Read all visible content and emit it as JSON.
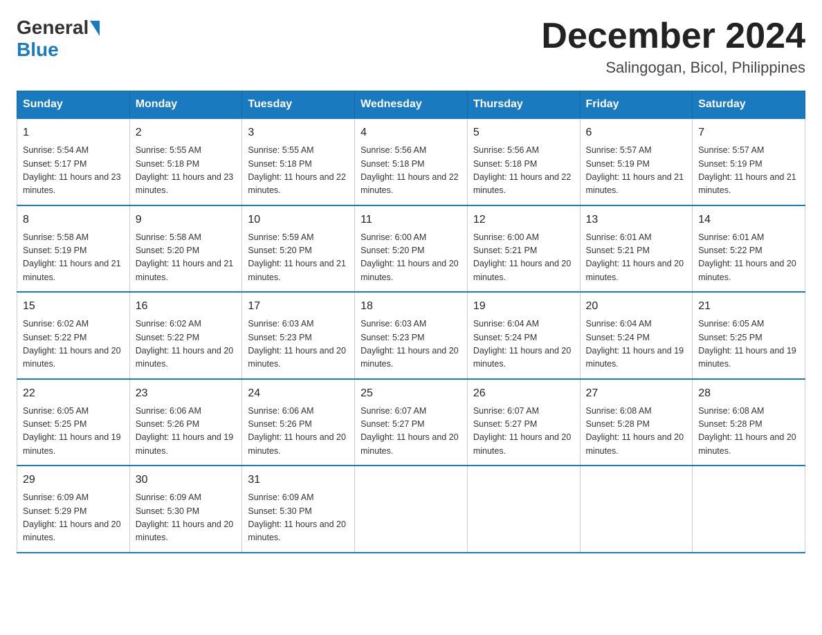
{
  "logo": {
    "general": "General",
    "blue": "Blue"
  },
  "title": "December 2024",
  "subtitle": "Salingogan, Bicol, Philippines",
  "days_of_week": [
    "Sunday",
    "Monday",
    "Tuesday",
    "Wednesday",
    "Thursday",
    "Friday",
    "Saturday"
  ],
  "weeks": [
    [
      {
        "day": "1",
        "sunrise": "5:54 AM",
        "sunset": "5:17 PM",
        "daylight": "11 hours and 23 minutes."
      },
      {
        "day": "2",
        "sunrise": "5:55 AM",
        "sunset": "5:18 PM",
        "daylight": "11 hours and 23 minutes."
      },
      {
        "day": "3",
        "sunrise": "5:55 AM",
        "sunset": "5:18 PM",
        "daylight": "11 hours and 22 minutes."
      },
      {
        "day": "4",
        "sunrise": "5:56 AM",
        "sunset": "5:18 PM",
        "daylight": "11 hours and 22 minutes."
      },
      {
        "day": "5",
        "sunrise": "5:56 AM",
        "sunset": "5:18 PM",
        "daylight": "11 hours and 22 minutes."
      },
      {
        "day": "6",
        "sunrise": "5:57 AM",
        "sunset": "5:19 PM",
        "daylight": "11 hours and 21 minutes."
      },
      {
        "day": "7",
        "sunrise": "5:57 AM",
        "sunset": "5:19 PM",
        "daylight": "11 hours and 21 minutes."
      }
    ],
    [
      {
        "day": "8",
        "sunrise": "5:58 AM",
        "sunset": "5:19 PM",
        "daylight": "11 hours and 21 minutes."
      },
      {
        "day": "9",
        "sunrise": "5:58 AM",
        "sunset": "5:20 PM",
        "daylight": "11 hours and 21 minutes."
      },
      {
        "day": "10",
        "sunrise": "5:59 AM",
        "sunset": "5:20 PM",
        "daylight": "11 hours and 21 minutes."
      },
      {
        "day": "11",
        "sunrise": "6:00 AM",
        "sunset": "5:20 PM",
        "daylight": "11 hours and 20 minutes."
      },
      {
        "day": "12",
        "sunrise": "6:00 AM",
        "sunset": "5:21 PM",
        "daylight": "11 hours and 20 minutes."
      },
      {
        "day": "13",
        "sunrise": "6:01 AM",
        "sunset": "5:21 PM",
        "daylight": "11 hours and 20 minutes."
      },
      {
        "day": "14",
        "sunrise": "6:01 AM",
        "sunset": "5:22 PM",
        "daylight": "11 hours and 20 minutes."
      }
    ],
    [
      {
        "day": "15",
        "sunrise": "6:02 AM",
        "sunset": "5:22 PM",
        "daylight": "11 hours and 20 minutes."
      },
      {
        "day": "16",
        "sunrise": "6:02 AM",
        "sunset": "5:22 PM",
        "daylight": "11 hours and 20 minutes."
      },
      {
        "day": "17",
        "sunrise": "6:03 AM",
        "sunset": "5:23 PM",
        "daylight": "11 hours and 20 minutes."
      },
      {
        "day": "18",
        "sunrise": "6:03 AM",
        "sunset": "5:23 PM",
        "daylight": "11 hours and 20 minutes."
      },
      {
        "day": "19",
        "sunrise": "6:04 AM",
        "sunset": "5:24 PM",
        "daylight": "11 hours and 20 minutes."
      },
      {
        "day": "20",
        "sunrise": "6:04 AM",
        "sunset": "5:24 PM",
        "daylight": "11 hours and 19 minutes."
      },
      {
        "day": "21",
        "sunrise": "6:05 AM",
        "sunset": "5:25 PM",
        "daylight": "11 hours and 19 minutes."
      }
    ],
    [
      {
        "day": "22",
        "sunrise": "6:05 AM",
        "sunset": "5:25 PM",
        "daylight": "11 hours and 19 minutes."
      },
      {
        "day": "23",
        "sunrise": "6:06 AM",
        "sunset": "5:26 PM",
        "daylight": "11 hours and 19 minutes."
      },
      {
        "day": "24",
        "sunrise": "6:06 AM",
        "sunset": "5:26 PM",
        "daylight": "11 hours and 20 minutes."
      },
      {
        "day": "25",
        "sunrise": "6:07 AM",
        "sunset": "5:27 PM",
        "daylight": "11 hours and 20 minutes."
      },
      {
        "day": "26",
        "sunrise": "6:07 AM",
        "sunset": "5:27 PM",
        "daylight": "11 hours and 20 minutes."
      },
      {
        "day": "27",
        "sunrise": "6:08 AM",
        "sunset": "5:28 PM",
        "daylight": "11 hours and 20 minutes."
      },
      {
        "day": "28",
        "sunrise": "6:08 AM",
        "sunset": "5:28 PM",
        "daylight": "11 hours and 20 minutes."
      }
    ],
    [
      {
        "day": "29",
        "sunrise": "6:09 AM",
        "sunset": "5:29 PM",
        "daylight": "11 hours and 20 minutes."
      },
      {
        "day": "30",
        "sunrise": "6:09 AM",
        "sunset": "5:30 PM",
        "daylight": "11 hours and 20 minutes."
      },
      {
        "day": "31",
        "sunrise": "6:09 AM",
        "sunset": "5:30 PM",
        "daylight": "11 hours and 20 minutes."
      },
      null,
      null,
      null,
      null
    ]
  ]
}
